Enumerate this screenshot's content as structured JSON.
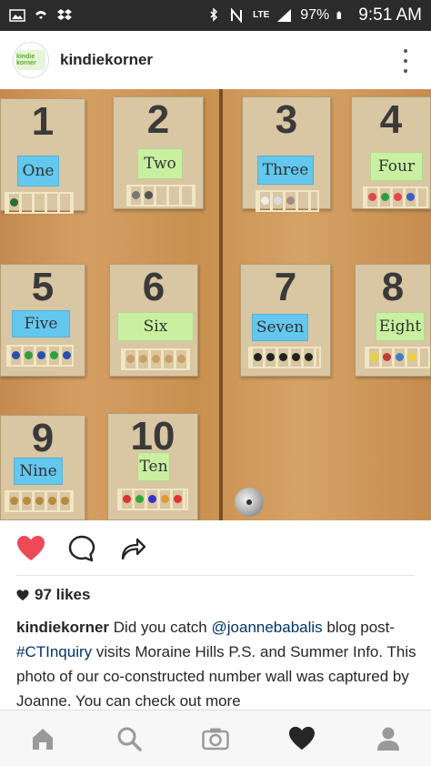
{
  "status_bar": {
    "battery": "97%",
    "time": "9:51 AM",
    "network": "LTE",
    "icons": [
      "image-icon",
      "shield-wifi-icon",
      "dropbox-icon",
      "bluetooth-icon",
      "nfc-icon",
      "signal-icon",
      "battery-icon"
    ]
  },
  "post": {
    "username": "kindiekorner",
    "avatar_text": "kindie korner",
    "photo_cards": [
      {
        "digit": "1",
        "label": "One",
        "label_color": "#63c7ee"
      },
      {
        "digit": "2",
        "label": "Two",
        "label_color": "#c8f0a0"
      },
      {
        "digit": "3",
        "label": "Three",
        "label_color": "#63c7ee"
      },
      {
        "digit": "4",
        "label": "Four",
        "label_color": "#c8f0a0"
      },
      {
        "digit": "5",
        "label": "Five",
        "label_color": "#63c7ee"
      },
      {
        "digit": "6",
        "label": "Six",
        "label_color": "#c8f0a0"
      },
      {
        "digit": "7",
        "label": "Seven",
        "label_color": "#63c7ee"
      },
      {
        "digit": "8",
        "label": "Eight",
        "label_color": "#c8f0a0"
      },
      {
        "digit": "9",
        "label": "Nine",
        "label_color": "#63c7ee"
      },
      {
        "digit": "10",
        "label": "Ten",
        "label_color": "#c8f0a0"
      }
    ],
    "likes": "97 likes",
    "caption_user": "kindiekorner",
    "caption_pre": " Did you catch ",
    "caption_mention": "@joannebabalis",
    "caption_mid": " blog post- ",
    "caption_hashtag": "#CTInquiry",
    "caption_post": " visits Moraine Hills P.S. and Summer Info. This photo of our co-constructed number wall was captured by Joanne. You can check out more"
  },
  "colors": {
    "like_red": "#ed4956",
    "text": "#262626",
    "link": "#003569"
  },
  "nav": [
    "home-icon",
    "search-icon",
    "camera-icon",
    "activity-heart-icon",
    "profile-icon"
  ]
}
